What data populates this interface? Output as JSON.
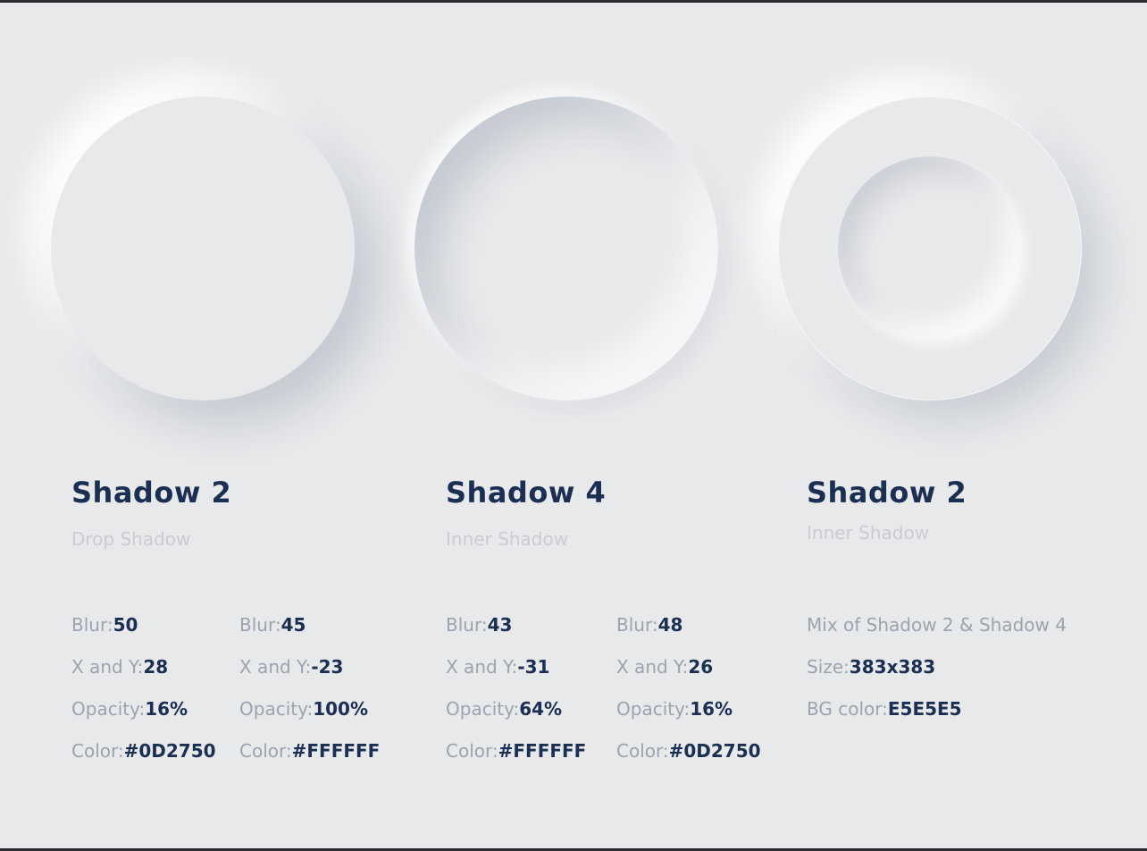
{
  "cards": [
    {
      "title": "Shadow 2",
      "subtitle": "Drop Shadow",
      "specs": [
        [
          {
            "label": "Blur:",
            "value": "50"
          },
          {
            "label": "X and Y:",
            "value": "28"
          },
          {
            "label": "Opacity:",
            "value": "16%"
          },
          {
            "label": "Color:",
            "value": "#0D2750"
          }
        ],
        [
          {
            "label": "Blur:",
            "value": "45"
          },
          {
            "label": "X and Y:",
            "value": "-23"
          },
          {
            "label": "Opacity:",
            "value": "100%"
          },
          {
            "label": "Color:",
            "value": "#FFFFFF"
          }
        ]
      ]
    },
    {
      "title": "Shadow 4",
      "subtitle": "Inner Shadow",
      "specs": [
        [
          {
            "label": "Blur:",
            "value": "43"
          },
          {
            "label": "X and Y:",
            "value": "-31"
          },
          {
            "label": "Opacity:",
            "value": "64%"
          },
          {
            "label": "Color:",
            "value": "#FFFFFF"
          }
        ],
        [
          {
            "label": "Blur:",
            "value": "48"
          },
          {
            "label": "X and Y:",
            "value": "26"
          },
          {
            "label": "Opacity:",
            "value": "16%"
          },
          {
            "label": "Color:",
            "value": "#0D2750"
          }
        ]
      ]
    },
    {
      "title": "Shadow 2",
      "subtitle": "Inner Shadow",
      "mix_text": "Mix of  Shadow 2   &  Shadow 4",
      "specs": [
        {
          "label": "Size:",
          "value": "383x383"
        },
        {
          "label": "BG color:",
          "value": "E5E5E5"
        }
      ]
    }
  ],
  "colors": {
    "background": "#e8e9eb",
    "title": "#1b2f52",
    "label": "#9ba3af",
    "subtitle": "#c9cdd3"
  }
}
